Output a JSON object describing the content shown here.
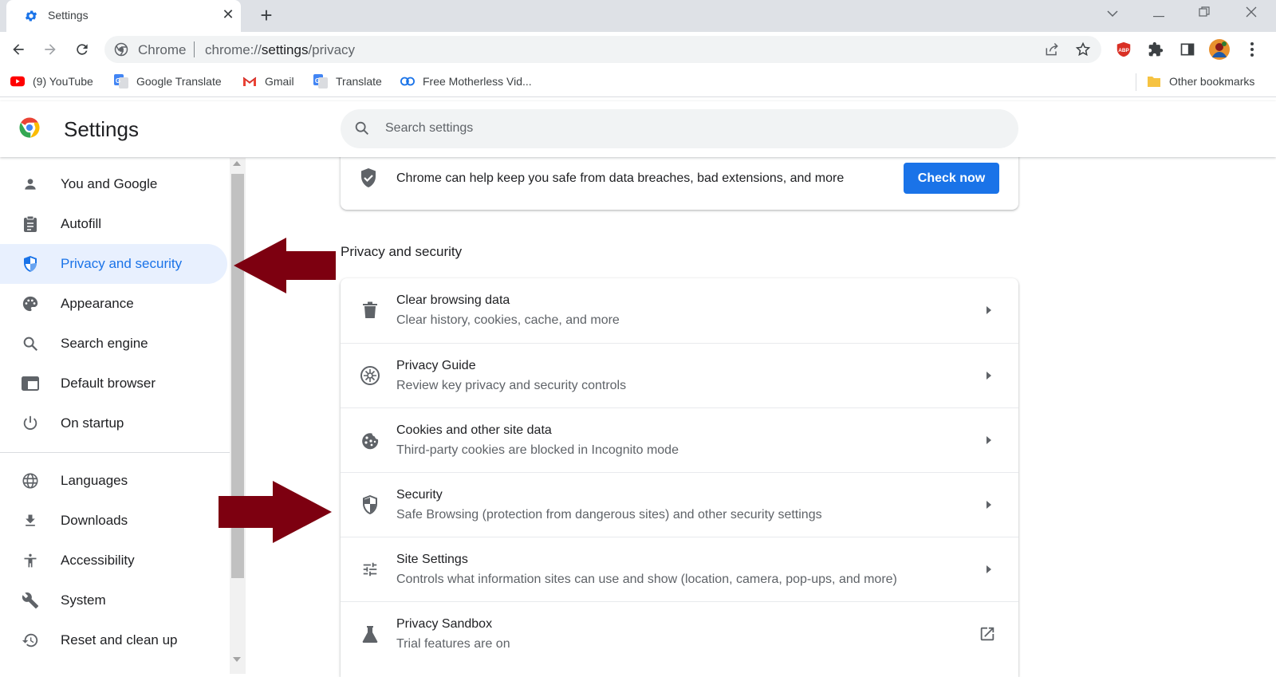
{
  "browser": {
    "tab_title": "Settings",
    "new_tab_symbol": "+",
    "omnibox_site_label": "Chrome",
    "url_scheme": "chrome://",
    "url_host": "settings",
    "url_path": "/privacy"
  },
  "bookmarks": [
    {
      "label": "(9) YouTube",
      "icon": "youtube-icon"
    },
    {
      "label": "Google Translate",
      "icon": "google-translate-icon"
    },
    {
      "label": "Gmail",
      "icon": "gmail-icon"
    },
    {
      "label": "Translate",
      "icon": "translate-icon"
    },
    {
      "label": "Free Motherless Vid...",
      "icon": "video-site-icon"
    },
    {
      "label": "Other bookmarks",
      "icon": "folder-icon"
    }
  ],
  "settings": {
    "title": "Settings",
    "search_placeholder": "Search settings"
  },
  "sidebar": {
    "items": [
      {
        "label": "You and Google",
        "icon": "person-icon",
        "active": false
      },
      {
        "label": "Autofill",
        "icon": "clipboard-icon",
        "active": false
      },
      {
        "label": "Privacy and security",
        "icon": "shield-icon",
        "active": true
      },
      {
        "label": "Appearance",
        "icon": "palette-icon",
        "active": false
      },
      {
        "label": "Search engine",
        "icon": "search-icon",
        "active": false
      },
      {
        "label": "Default browser",
        "icon": "browser-window-icon",
        "active": false
      },
      {
        "label": "On startup",
        "icon": "power-icon",
        "active": false
      },
      {
        "label": "Languages",
        "icon": "globe-icon",
        "active": false
      },
      {
        "label": "Downloads",
        "icon": "download-icon",
        "active": false
      },
      {
        "label": "Accessibility",
        "icon": "accessibility-icon",
        "active": false
      },
      {
        "label": "System",
        "icon": "wrench-icon",
        "active": false
      },
      {
        "label": "Reset and clean up",
        "icon": "history-icon",
        "active": false
      }
    ]
  },
  "main": {
    "safety_check": {
      "text": "Chrome can help keep you safe from data breaches, bad extensions, and more",
      "button": "Check now"
    },
    "section_title": "Privacy and security",
    "rows": [
      {
        "title": "Clear browsing data",
        "subtitle": "Clear history, cookies, cache, and more",
        "icon": "trash-icon",
        "action": "chevron"
      },
      {
        "title": "Privacy Guide",
        "subtitle": "Review key privacy and security controls",
        "icon": "compass-icon",
        "action": "chevron"
      },
      {
        "title": "Cookies and other site data",
        "subtitle": "Third-party cookies are blocked in Incognito mode",
        "icon": "cookie-icon",
        "action": "chevron"
      },
      {
        "title": "Security",
        "subtitle": "Safe Browsing (protection from dangerous sites) and other security settings",
        "icon": "security-shield-icon",
        "action": "chevron"
      },
      {
        "title": "Site Settings",
        "subtitle": "Controls what information sites can use and show (location, camera, pop-ups, and more)",
        "icon": "tune-icon",
        "action": "chevron"
      },
      {
        "title": "Privacy Sandbox",
        "subtitle": "Trial features are on",
        "icon": "flask-icon",
        "action": "external"
      }
    ]
  },
  "colors": {
    "accent": "#1a73e8",
    "active_bg": "#e8f0fe",
    "annotation_arrow": "#7d0010"
  }
}
